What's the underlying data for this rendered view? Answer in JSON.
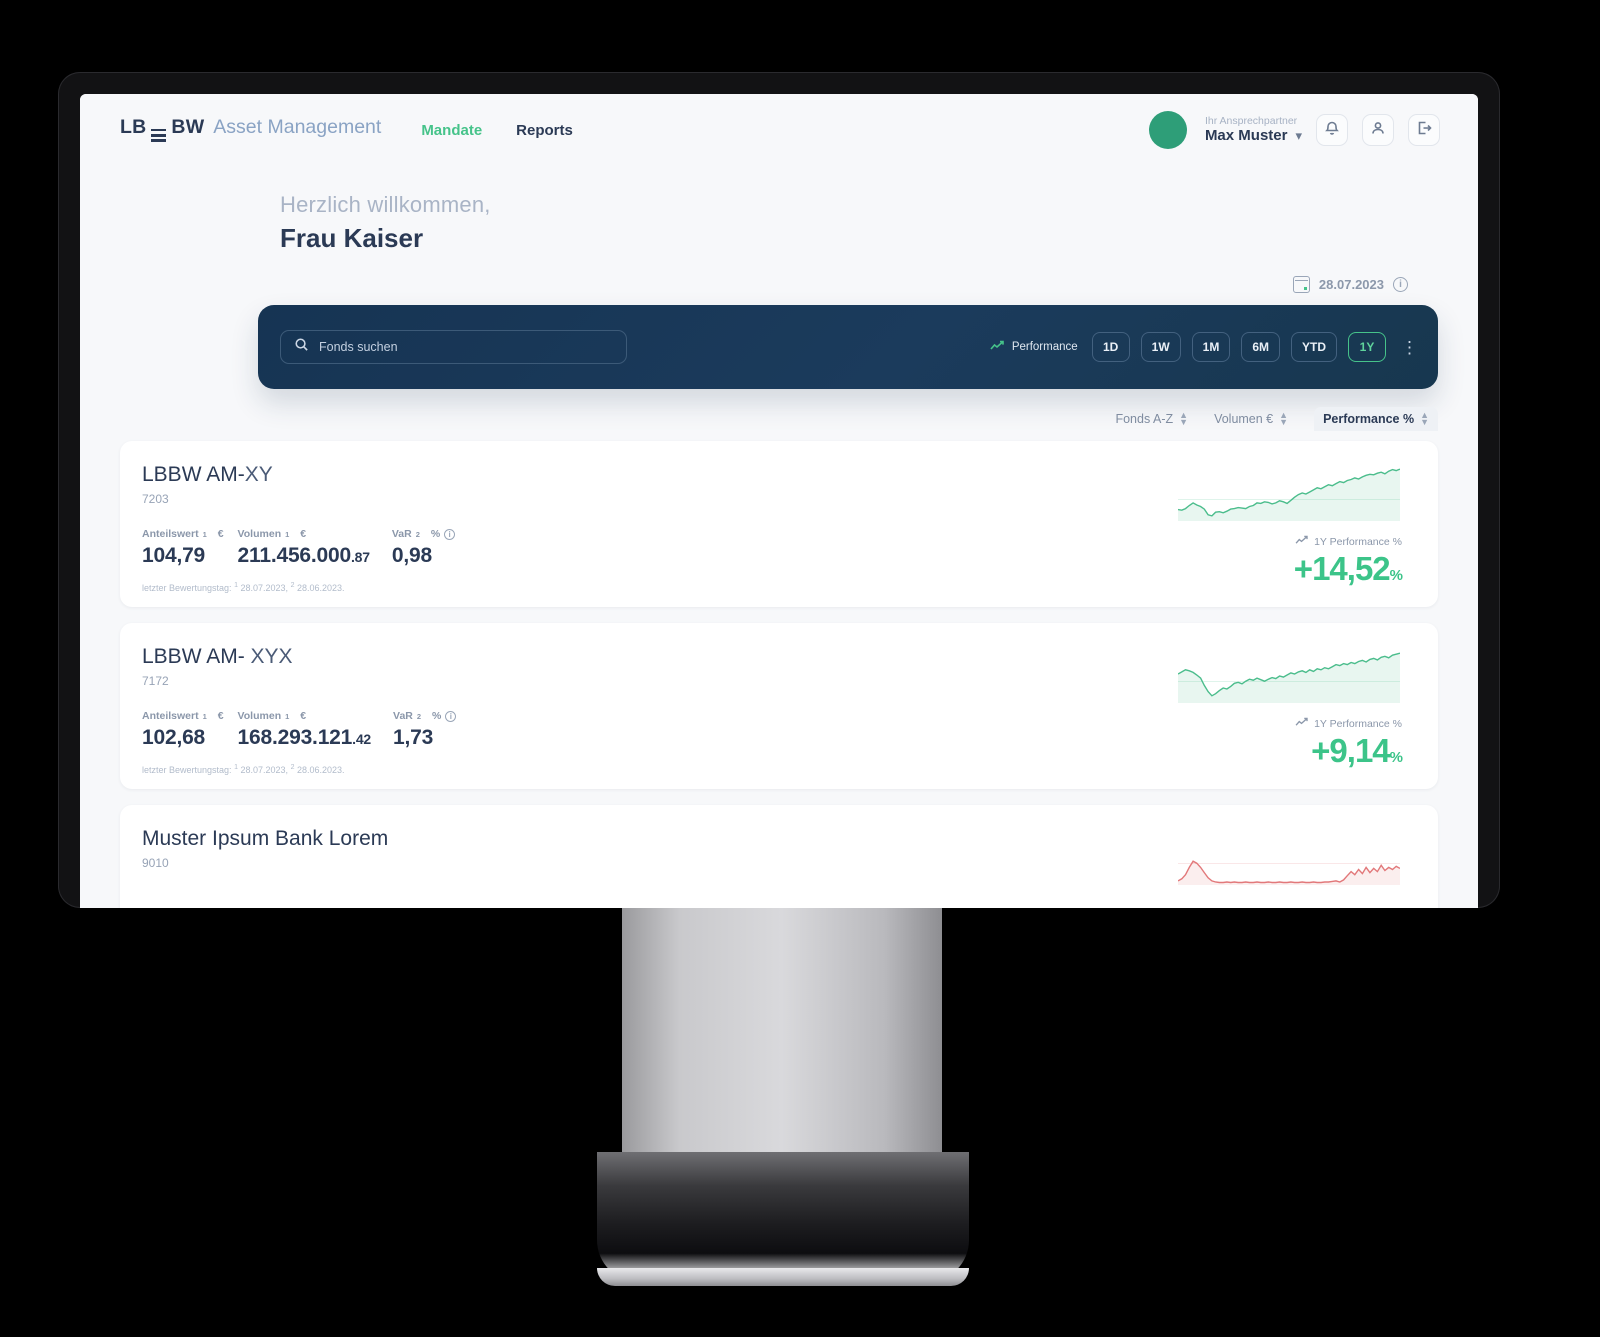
{
  "header": {
    "brand_lb": "LB",
    "brand_bw": "BW",
    "brand_suffix": "Asset Management",
    "nav": [
      {
        "label": "Mandate",
        "active": true
      },
      {
        "label": "Reports",
        "active": false
      }
    ],
    "user_role": "Ihr Ansprechpartner",
    "user_name": "Max Muster",
    "chevron": "⌄",
    "icons": [
      "bell-icon",
      "user-icon",
      "logout-icon"
    ]
  },
  "welcome": {
    "greeting": "Herzlich willkommen,",
    "salutation": "Frau",
    "name": "Kaiser"
  },
  "date_row": {
    "date": "28.07.2023",
    "info_glyph": "i"
  },
  "search": {
    "placeholder": "Fonds suchen",
    "value": "",
    "performance_label": "Performance",
    "ranges": [
      {
        "label": "1D",
        "active": false
      },
      {
        "label": "1W",
        "active": false
      },
      {
        "label": "1M",
        "active": false
      },
      {
        "label": "6M",
        "active": false
      },
      {
        "label": "YTD",
        "active": false
      },
      {
        "label": "1Y",
        "active": true
      }
    ],
    "kebab": "⋮"
  },
  "sort": {
    "items": [
      {
        "label": "Fonds A-Z",
        "active": false
      },
      {
        "label": "Volumen €",
        "active": false
      },
      {
        "label": "Performance %",
        "active": true
      }
    ]
  },
  "columns": {
    "anteilswert": "Anteilswert",
    "anteilswert_sup": "1",
    "anteilswert_unit": "€",
    "volumen": "Volumen",
    "volumen_sup": "1",
    "volumen_unit": "€",
    "var": "VaR",
    "var_sup": "2",
    "var_unit": "%",
    "footnote_prefix": "letzter Bewertungstag:",
    "footnote_date1": "28.07.2023,",
    "footnote_date2": "28.06.2023.",
    "perf_caption": "1Y Performance %"
  },
  "funds": [
    {
      "name_main": "LBBW AM-",
      "name_suffix": "XY",
      "id": "7203",
      "anteilswert": "104,79",
      "volumen_int": "211.456.000",
      "volumen_dec": ".87",
      "var": "0,98",
      "performance": "+14,52",
      "performance_unit": "%",
      "trend": "up"
    },
    {
      "name_main": "LBBW AM- ",
      "name_suffix": "XYX",
      "id": "7172",
      "anteilswert": "102,68",
      "volumen_int": "168.293.121",
      "volumen_dec": ".42",
      "var": "1,73",
      "performance": "+9,14",
      "performance_unit": "%",
      "trend": "up"
    },
    {
      "name_main": "Muster Ipsum Bank Lorem",
      "name_suffix": "",
      "id": "9010",
      "anteilswert": "",
      "volumen_int": "",
      "volumen_dec": "",
      "var": "",
      "performance": "",
      "performance_unit": "%",
      "trend": "down"
    }
  ],
  "chart_data": [
    {
      "type": "line",
      "title": "LBBW AM-XY 1Y Performance",
      "series": [
        {
          "name": "1Y Performance",
          "values": [
            18,
            17,
            20,
            26,
            31,
            27,
            24,
            19,
            8,
            6,
            13,
            14,
            12,
            15,
            19,
            20,
            22,
            21,
            20,
            24,
            26,
            31,
            30,
            33,
            32,
            29,
            31,
            35,
            33,
            30,
            36,
            42,
            47,
            50,
            48,
            52,
            56,
            60,
            58,
            62,
            66,
            64,
            68,
            72,
            70,
            74,
            76,
            79,
            77,
            81,
            84,
            86,
            85,
            88,
            90,
            87,
            92,
            95,
            93,
            96
          ]
        }
      ],
      "ylim": [
        0,
        100
      ],
      "grid": false,
      "color": "#4bbd8c"
    },
    {
      "type": "line",
      "title": "LBBW AM-XYX 1Y Performance",
      "series": [
        {
          "name": "1Y Performance",
          "values": [
            52,
            56,
            60,
            58,
            55,
            50,
            44,
            30,
            18,
            10,
            14,
            20,
            25,
            23,
            28,
            34,
            36,
            33,
            38,
            42,
            40,
            44,
            41,
            38,
            42,
            45,
            43,
            48,
            46,
            50,
            54,
            52,
            56,
            58,
            55,
            60,
            57,
            62,
            60,
            64,
            62,
            66,
            70,
            68,
            72,
            70,
            74,
            72,
            76,
            78,
            75,
            80,
            82,
            79,
            84,
            86,
            83,
            88,
            90,
            92
          ]
        }
      ],
      "ylim": [
        0,
        100
      ],
      "grid": false,
      "color": "#4bbd8c"
    },
    {
      "type": "line",
      "title": "Muster Ipsum Bank Lorem 1Y Performance",
      "series": [
        {
          "name": "1Y Performance",
          "values": [
            4,
            8,
            16,
            30,
            42,
            38,
            30,
            20,
            10,
            4,
            2,
            1,
            1,
            2,
            1,
            2,
            1,
            1,
            2,
            1,
            1,
            2,
            1,
            1,
            2,
            1,
            1,
            2,
            1,
            1,
            2,
            1,
            1,
            2,
            1,
            1,
            2,
            1,
            1,
            2,
            2,
            3,
            4,
            2,
            6,
            14,
            22,
            16,
            26,
            18,
            30,
            20,
            28,
            22,
            34,
            24,
            30,
            26,
            32,
            28
          ]
        }
      ],
      "ylim": [
        0,
        100
      ],
      "grid": false,
      "color": "#e2787a"
    }
  ]
}
